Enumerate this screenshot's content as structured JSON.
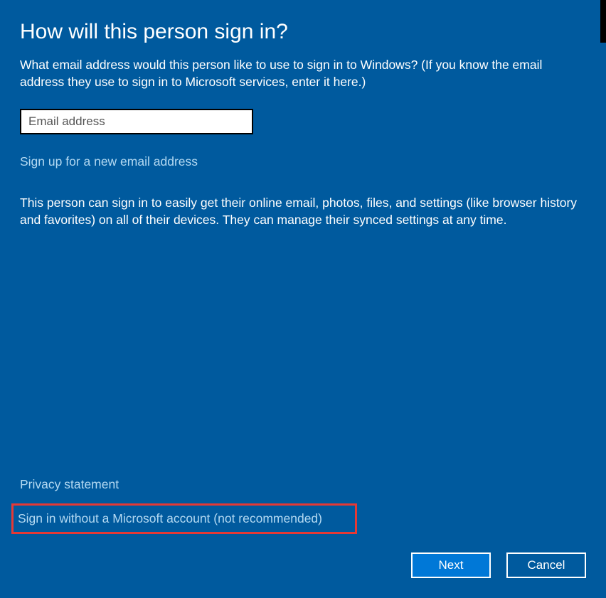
{
  "title": "How will this person sign in?",
  "description": "What email address would this person like to use to sign in to Windows? (If you know the email address they use to sign in to Microsoft services, enter it here.)",
  "email_input": {
    "placeholder": "Email address",
    "value": ""
  },
  "signup_link": "Sign up for a new email address",
  "sync_text": "This person can sign in to easily get their online email, photos, files, and settings (like browser history and favorites) on all of their devices. They can manage their synced settings at any time.",
  "privacy_link": "Privacy statement",
  "no_account_link": "Sign in without a Microsoft account (not recommended)",
  "buttons": {
    "next": "Next",
    "cancel": "Cancel"
  }
}
